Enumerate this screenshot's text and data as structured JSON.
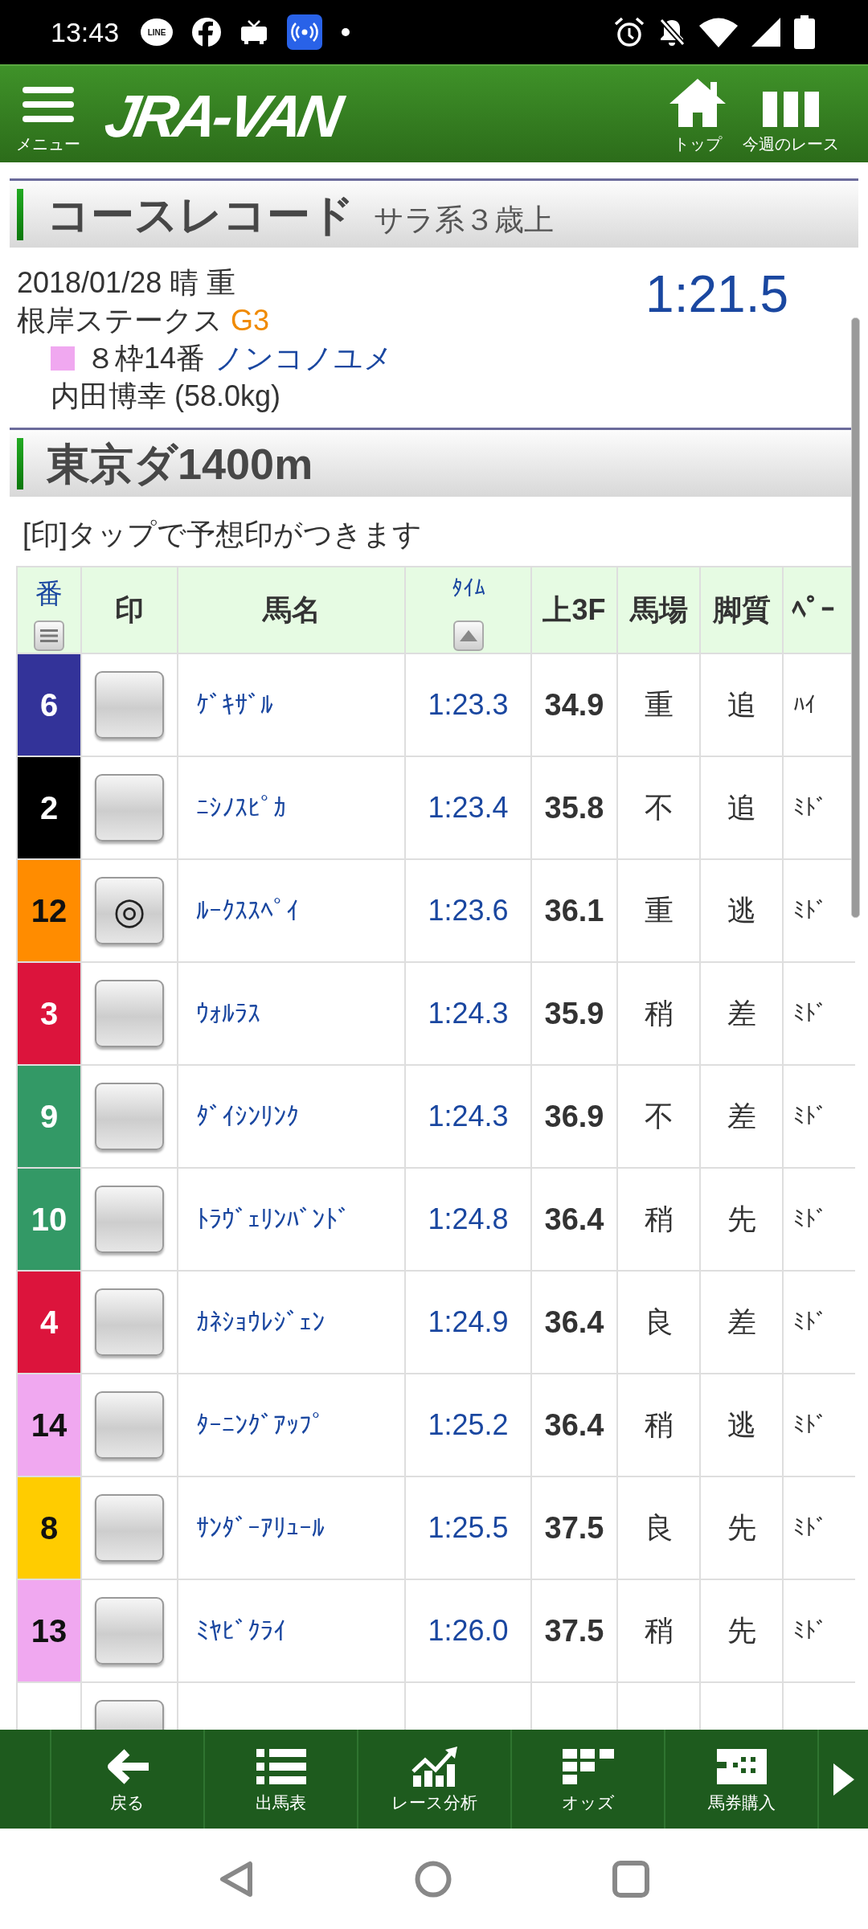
{
  "status_bar": {
    "time": "13:43",
    "notification_icons": [
      {
        "kind": "line",
        "label": "LINE"
      },
      {
        "kind": "facebook"
      },
      {
        "kind": "tv"
      },
      {
        "kind": "broadcast"
      },
      {
        "kind": "dot"
      }
    ],
    "system_icons": [
      {
        "kind": "alarm"
      },
      {
        "kind": "bell_off"
      },
      {
        "kind": "wifi"
      },
      {
        "kind": "signal"
      },
      {
        "kind": "battery"
      }
    ]
  },
  "header": {
    "menu_label": "メニュー",
    "logo": "JRA-VAN",
    "actions": [
      {
        "kind": "home",
        "label": "トップ"
      },
      {
        "kind": "week",
        "label": "今週のレース"
      }
    ]
  },
  "course_record": {
    "title": "コースレコード",
    "subtitle": "サラ系３歳上",
    "date_weather": "2018/01/28 晴 重",
    "race": "根岸ステークス",
    "grade": "G3",
    "entry": {
      "color": "#f0a8f0",
      "position": "８枠14番",
      "horse": "ノンコノユメ"
    },
    "jockey": "内田博幸 (58.0kg)",
    "time": "1:21.5"
  },
  "course": {
    "title": "東京ダ1400m",
    "note": "[印]タップで予想印がつきます"
  },
  "table": {
    "columns": [
      {
        "label": "番",
        "kind": "menu"
      },
      {
        "label": "印",
        "kind": "plain"
      },
      {
        "label": "馬名",
        "kind": "plain"
      },
      {
        "label": "ﾀｲﾑ",
        "kind": "sort"
      },
      {
        "label": "上3F",
        "kind": "plain"
      },
      {
        "label": "馬場",
        "kind": "plain"
      },
      {
        "label": "脚質",
        "kind": "plain"
      },
      {
        "label": "ﾍﾟｰ",
        "kind": "plain"
      }
    ],
    "rows": [
      {
        "number": "6",
        "color": "#333399",
        "name": "ｹﾞｷｻﾞﾙ",
        "time": "1:23.3",
        "last_3f": "34.9",
        "track": "重",
        "style": "追",
        "pace": "ﾊｲ"
      },
      {
        "number": "2",
        "color": "#000000",
        "name": "ﾆｼﾉｽﾋﾟｶ",
        "time": "1:23.4",
        "last_3f": "35.8",
        "track": "不",
        "style": "追",
        "pace": "ﾐﾄﾞ"
      },
      {
        "number": "12",
        "color": "#ff8c00",
        "mark": "◎",
        "name": "ﾙｰｸｽｽﾍﾟｲ",
        "time": "1:23.6",
        "last_3f": "36.1",
        "track": "重",
        "style": "逃",
        "pace": "ﾐﾄﾞ"
      },
      {
        "number": "3",
        "color": "#dc143c",
        "name": "ｳｫﾙﾗｽ",
        "time": "1:24.3",
        "last_3f": "35.9",
        "track": "稍",
        "style": "差",
        "pace": "ﾐﾄﾞ"
      },
      {
        "number": "9",
        "color": "#339966",
        "name": "ﾀﾞｲｼﾝﾘﾝｸ",
        "time": "1:24.3",
        "last_3f": "36.9",
        "track": "不",
        "style": "差",
        "pace": "ﾐﾄﾞ"
      },
      {
        "number": "10",
        "color": "#339966",
        "name": "ﾄﾗｳﾞｪﾘﾝﾊﾞﾝﾄﾞ",
        "time": "1:24.8",
        "last_3f": "36.4",
        "track": "稍",
        "style": "先",
        "pace": "ﾐﾄﾞ"
      },
      {
        "number": "4",
        "color": "#dc143c",
        "name": "ｶﾈｼｮｳﾚｼﾞｪﾝ",
        "time": "1:24.9",
        "last_3f": "36.4",
        "track": "良",
        "style": "差",
        "pace": "ﾐﾄﾞ"
      },
      {
        "number": "14",
        "color": "#f0a8f0",
        "name": "ﾀｰﾆﾝｸﾞｱｯﾌﾟ",
        "time": "1:25.2",
        "last_3f": "36.4",
        "track": "稍",
        "style": "逃",
        "pace": "ﾐﾄﾞ"
      },
      {
        "number": "8",
        "color": "#ffcc00",
        "name": "ｻﾝﾀﾞｰｱﾘｭｰﾙ",
        "time": "1:25.5",
        "last_3f": "37.5",
        "track": "良",
        "style": "先",
        "pace": "ﾐﾄﾞ"
      },
      {
        "number": "13",
        "color": "#f0a8f0",
        "name": "ﾐﾔﾋﾞｸﾗｲ",
        "time": "1:26.0",
        "last_3f": "37.5",
        "track": "稍",
        "style": "先",
        "pace": "ﾐﾄﾞ"
      },
      {
        "color": "#ffffff"
      }
    ]
  },
  "bottom_nav": {
    "items": [
      {
        "kind": "back",
        "label": "戻る"
      },
      {
        "kind": "list",
        "label": "出馬表"
      },
      {
        "kind": "analysis",
        "label": "レース分析"
      },
      {
        "kind": "odds",
        "label": "オッズ"
      },
      {
        "kind": "ticket",
        "label": "馬券購入"
      }
    ]
  }
}
